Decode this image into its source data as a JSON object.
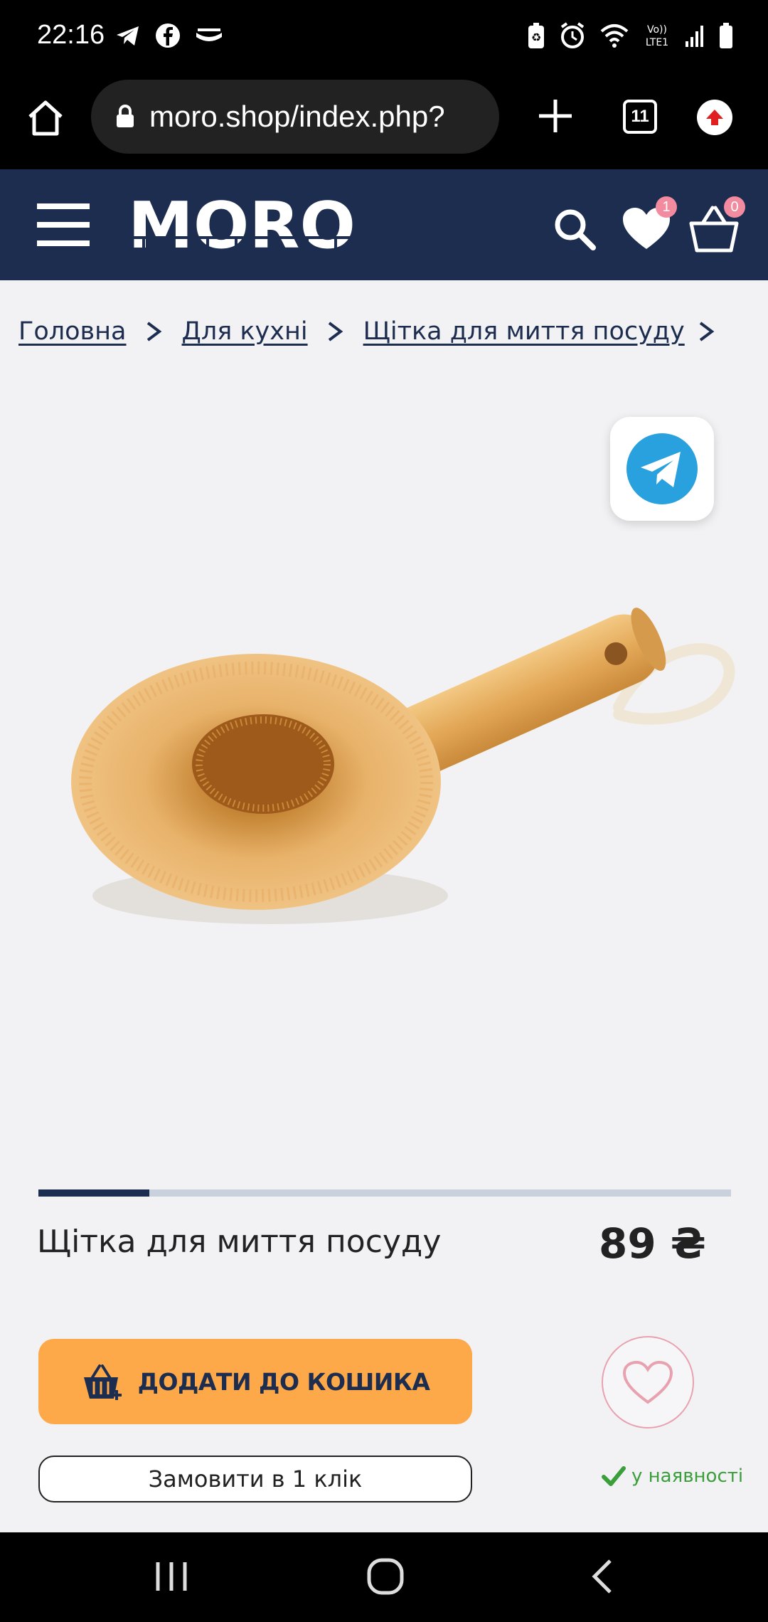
{
  "status_bar": {
    "time": "22:16",
    "left_icons": [
      "telegram-icon",
      "facebook-icon",
      "mail-icon"
    ],
    "right_icons": [
      "battery-saver-icon",
      "alarm-icon",
      "wifi-icon",
      "volte-icon",
      "signal-icon",
      "battery-icon"
    ],
    "volte_text": "Vo))\nLTE1"
  },
  "browser": {
    "url": "moro.shop/index.php?",
    "tabs_count": "11"
  },
  "header": {
    "logo_text": "MORO",
    "wishlist_count": "1",
    "cart_count": "0",
    "brand_color": "#1d2d4f"
  },
  "breadcrumb": {
    "items": [
      "Головна",
      "Для кухні",
      "Щітка для миття посуду"
    ]
  },
  "product": {
    "title": "Щітка для миття посуду",
    "price": "89 ₴",
    "image_progress": 0.16,
    "add_to_cart_label": "ДОДАТИ ДО КОШИКА",
    "one_click_label": "Замовити в 1 клік",
    "stock_label": "у наявності",
    "accent_color": "#fda949"
  }
}
